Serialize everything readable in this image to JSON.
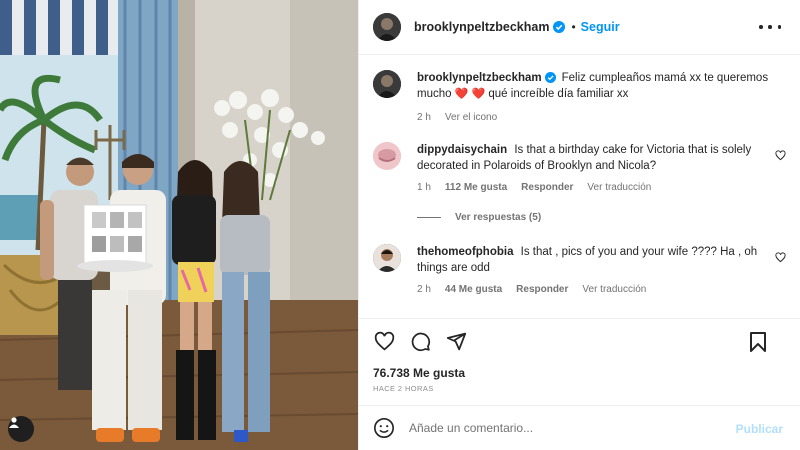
{
  "post": {
    "username": "brooklynpeltzbeckham",
    "follow_label": "Seguir",
    "dot_separator": "•",
    "more_icon": "more-horizontal-icon",
    "caption": {
      "username": "brooklynpeltzbeckham",
      "text": "Feliz cumpleaños mamá xx te queremos mucho",
      "emoji": "❤️ ❤️",
      "text_after": "qué increíble día familiar xx",
      "time": "2 h",
      "translate": "Ver el icono"
    },
    "comments": [
      {
        "username": "dippydaisychain",
        "text": "Is that a birthday cake for Victoria that is solely decorated in Polaroids of Brooklyn and Nicola?",
        "time": "1 h",
        "likes": "112 Me gusta",
        "reply": "Responder",
        "translate": "Ver traducción"
      },
      {
        "username": "thehomeofphobia",
        "text": "Is that , pics of you and your wife ???? Ha , oh things are odd",
        "time": "2 h",
        "likes": "44 Me gusta",
        "reply": "Responder",
        "translate": "Ver traducción"
      }
    ],
    "view_replies": "Ver respuestas (5)",
    "likes_count": "76.738 Me gusta",
    "posted_ago": "HACE 2 HORAS",
    "add_comment_placeholder": "Añade un comentario...",
    "publish_label": "Publicar",
    "colors": {
      "accent": "#0095f6",
      "heart": "#ed4956",
      "publish_disabled": "#b2dffc",
      "muted": "#737373"
    }
  }
}
